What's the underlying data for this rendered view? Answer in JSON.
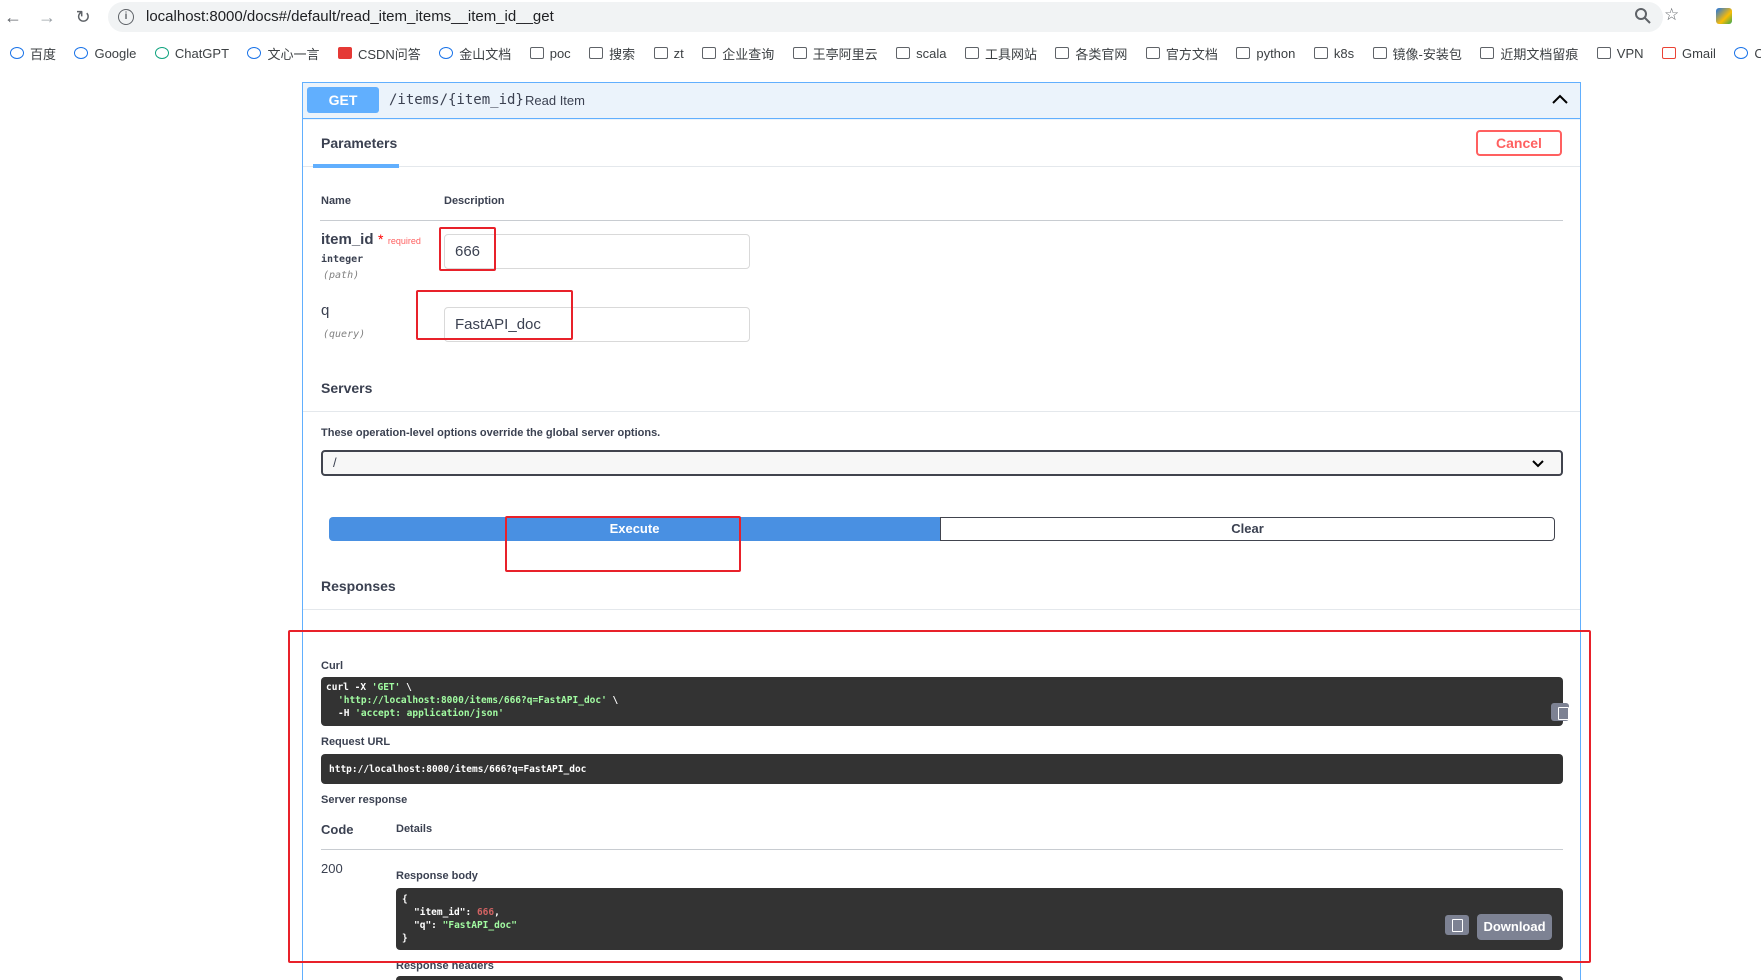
{
  "browser": {
    "url": "localhost:8000/docs#/default/read_item_items__item_id__get",
    "bookmarks": [
      "百度",
      "Google",
      "ChatGPT",
      "文心一言",
      "CSDN问答",
      "金山文档",
      "poc",
      "搜索",
      "zt",
      "企业查询",
      "王亭阿里云",
      "scala",
      "工具网站",
      "各类官网",
      "官方文档",
      "python",
      "k8s",
      "镜像-安装包",
      "近期文档留痕",
      "VPN",
      "Gmail",
      "Ch"
    ]
  },
  "operation": {
    "method": "GET",
    "path": "/items/{item_id}",
    "summary": "Read Item"
  },
  "parameters": {
    "tab_label": "Parameters",
    "cancel_label": "Cancel",
    "col_name": "Name",
    "col_description": "Description",
    "items": [
      {
        "name": "item_id",
        "required_mark": "*",
        "required_text": "required",
        "type": "integer",
        "in": "(path)",
        "value": "666"
      },
      {
        "name": "q",
        "in": "(query)",
        "value": "FastAPI_doc"
      }
    ]
  },
  "servers": {
    "title": "Servers",
    "note": "These operation-level options override the global server options.",
    "selected": "/"
  },
  "actions": {
    "execute": "Execute",
    "clear": "Clear"
  },
  "responses": {
    "title": "Responses",
    "curl_label": "Curl",
    "curl_lines": {
      "l1_cmd": "curl -X ",
      "l1_str": "'GET'",
      "l1_end": " \\",
      "l2_str": "'http://localhost:8000/items/666?q=FastAPI_doc'",
      "l2_end": " \\",
      "l3_cmd": "-H ",
      "l3_str": "'accept: application/json'"
    },
    "request_url_label": "Request URL",
    "request_url": "http://localhost:8000/items/666?q=FastAPI_doc",
    "server_response_label": "Server response",
    "code_header": "Code",
    "details_header": "Details",
    "code": "200",
    "response_body_label": "Response body",
    "body": {
      "open": "{",
      "key1": "\"item_id\"",
      "val1": "666",
      "key2": "\"q\"",
      "val2": "\"FastAPI_doc\"",
      "close": "}"
    },
    "download_label": "Download",
    "response_headers_label": "Response headers"
  },
  "colors": {
    "get_blue": "#61affe",
    "execute_blue": "#4990e2",
    "cancel_red": "#ff6060",
    "annotation_red": "#e8212a",
    "code_bg": "#333333"
  }
}
